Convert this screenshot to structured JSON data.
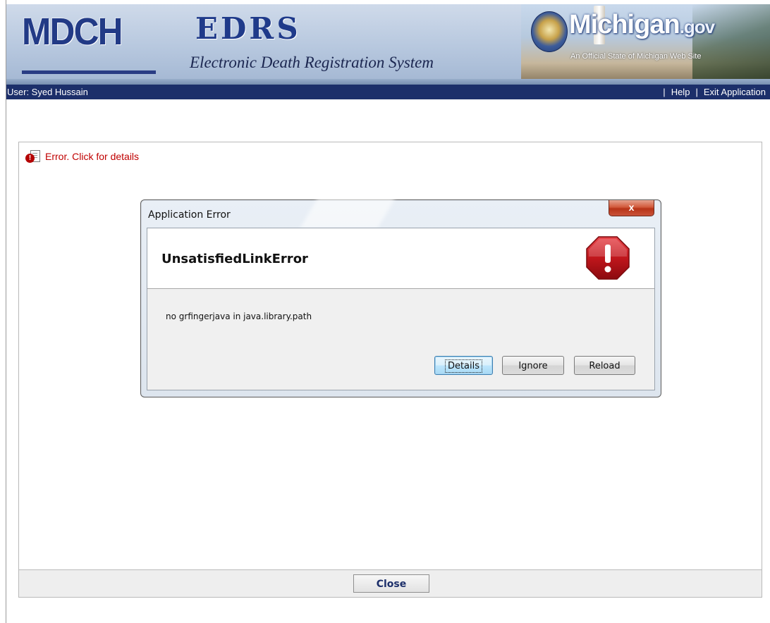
{
  "header": {
    "logo_text": "MDCH",
    "app_title": "EDRS",
    "app_subtitle": "Electronic Death Registration System",
    "portal_logo_text": "Michigan",
    "portal_logo_suffix": ".gov",
    "portal_tagline": "An Official State of Michigan Web Site"
  },
  "userbar": {
    "user_label": "User: Syed Hussain",
    "links": [
      "Help",
      "Exit Application"
    ]
  },
  "notice": {
    "error_link": "Error. Click for details",
    "icon": "error-document-icon"
  },
  "dialog": {
    "title": "Application Error",
    "close_glyph": "x",
    "error_name": "UnsatisfiedLinkError",
    "error_icon": "stop-exclamation-icon",
    "message": "no grfingerjava in java.library.path",
    "buttons": {
      "details": "Details",
      "ignore": "Ignore",
      "reload": "Reload"
    }
  },
  "footer": {
    "close_label": "Close"
  },
  "colors": {
    "userbar_bg": "#1c2f6a",
    "error_text": "#c00000",
    "brand_blue": "#1f3a8a",
    "stop_red": "#c0161c"
  }
}
